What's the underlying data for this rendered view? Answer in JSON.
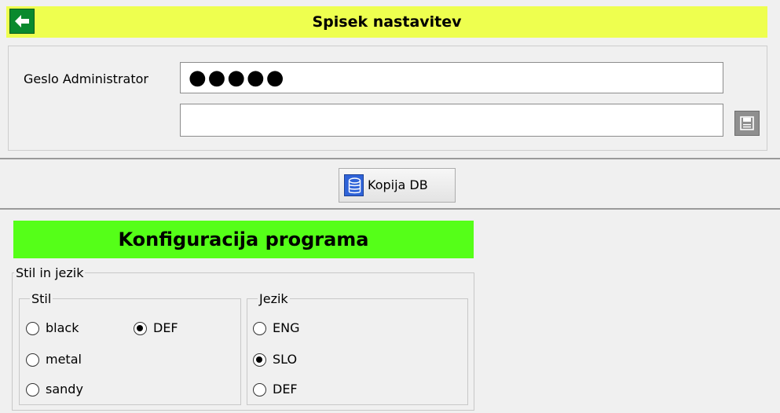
{
  "header": {
    "title": "Spisek nastavitev"
  },
  "password": {
    "label": "Geslo Administrator",
    "masked_value": "●●●●●",
    "confirm_value": ""
  },
  "backup": {
    "label": "Kopija DB"
  },
  "config": {
    "title": "Konfiguracija programa",
    "group_label": "Stil in jezik",
    "style": {
      "label": "Stil",
      "options": [
        {
          "label": "black",
          "checked": false
        },
        {
          "label": "DEF",
          "checked": true
        },
        {
          "label": "metal",
          "checked": false
        },
        {
          "label": "sandy",
          "checked": false
        }
      ]
    },
    "language": {
      "label": "Jezik",
      "options": [
        {
          "label": "ENG",
          "checked": false
        },
        {
          "label": "SLO",
          "checked": true
        },
        {
          "label": "DEF",
          "checked": false
        }
      ]
    }
  },
  "colors": {
    "header_bg": "#eeff4f",
    "config_title_bg": "#55ff18",
    "back_button": "#0a8a2e",
    "db_icon": "#2f63d8"
  }
}
